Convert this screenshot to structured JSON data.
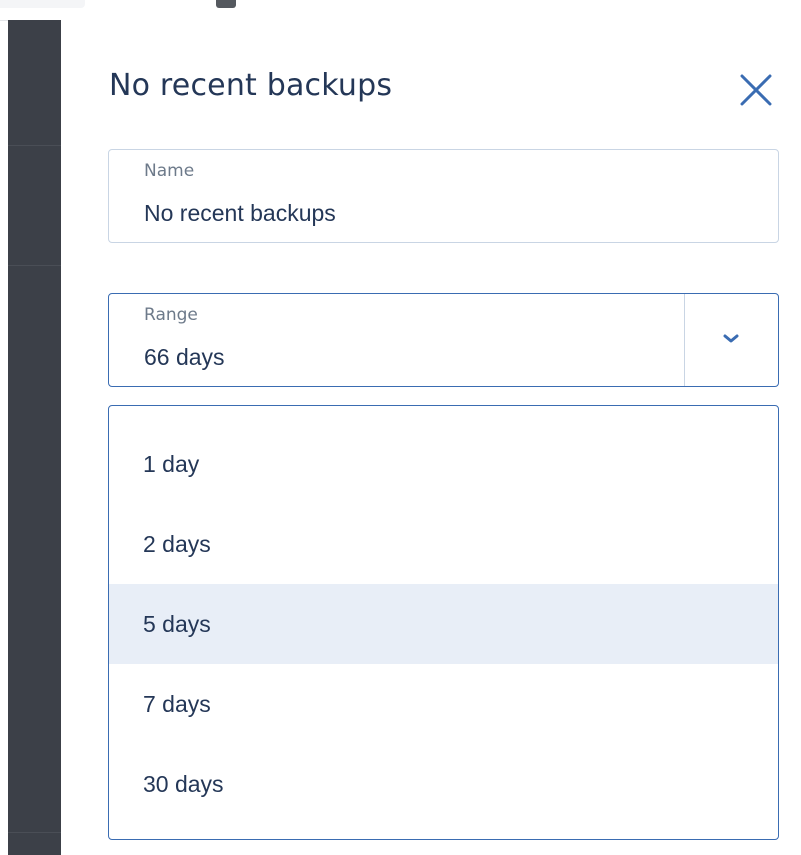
{
  "panel": {
    "title": "No recent backups",
    "close_icon": "close-icon"
  },
  "name_field": {
    "label": "Name",
    "value": "No recent backups"
  },
  "range_field": {
    "label": "Range",
    "value": "66 days",
    "toggle_icon": "chevron-down-icon"
  },
  "range_options": [
    {
      "label": "1 day"
    },
    {
      "label": "2 days"
    },
    {
      "label": "5 days",
      "highlighted": true
    },
    {
      "label": "7 days"
    },
    {
      "label": "30 days"
    }
  ],
  "colors": {
    "accent": "#3a6cb2",
    "text": "#243757",
    "label": "#6d7a8a",
    "option_highlight": "#e8eef7",
    "sidebar": "#3c4048"
  }
}
